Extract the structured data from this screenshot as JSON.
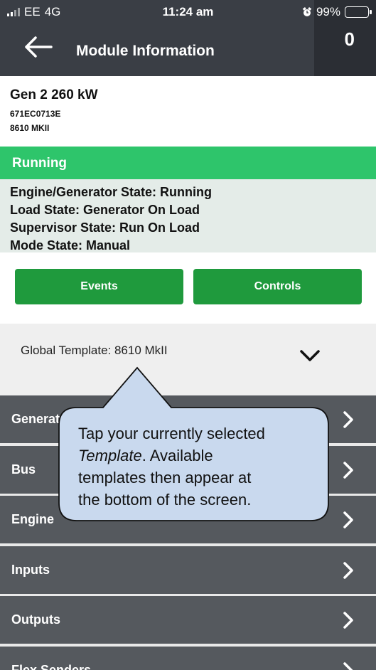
{
  "status_bar": {
    "carrier": "EE",
    "network": "4G",
    "time": "11:24 am",
    "battery": "99%",
    "alarm_icon": "alarm-clock-icon"
  },
  "header": {
    "back_icon": "back-arrow-icon",
    "title": "Module Information",
    "counter": "0"
  },
  "module": {
    "name": "Gen 2 260 kW",
    "serial": "671EC0713E",
    "model": "8610 MKII"
  },
  "state_banner": {
    "label": "Running",
    "color": "#2ec56b"
  },
  "states": [
    "Engine/Generator State: Running",
    "Load State: Generator On Load",
    "Supervisor State: Run On Load",
    "Mode State: Manual"
  ],
  "buttons": {
    "events": "Events",
    "controls": "Controls",
    "color": "#1f9a3d"
  },
  "template": {
    "label": "Global Template: 8610 MkII",
    "icon": "chevron-down-icon"
  },
  "menu": [
    "Generator",
    "Bus",
    "Engine",
    "Inputs",
    "Outputs",
    "Flex Senders"
  ],
  "callout": {
    "line1": "Tap your currently selected",
    "emph": "Template",
    "line2_rest": ". Available",
    "line3": "templates then appear at",
    "line4": "the bottom of the screen."
  }
}
